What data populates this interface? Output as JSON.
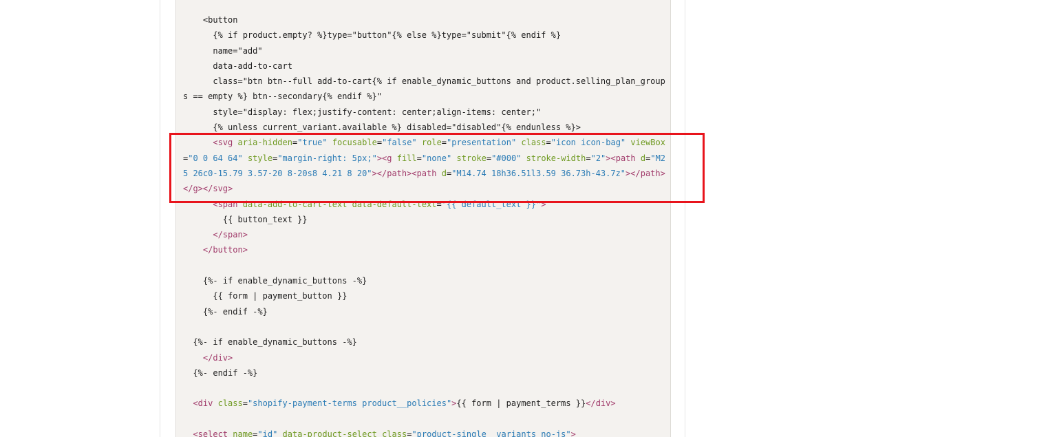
{
  "colors": {
    "code_background": "#f4f2ef",
    "text": "#1f1f1f",
    "tag": "#a03a6a",
    "attribute": "#6f9a22",
    "value": "#2a7bb5",
    "highlight_border": "#e8141c"
  },
  "code": {
    "language": "liquid-html",
    "lines": [
      [
        {
          "t": "text",
          "s": "    <button"
        }
      ],
      [
        {
          "t": "text",
          "s": "      {% if product.empty? %}type=\"button\"{% else %}type=\"submit\"{% endif %}"
        }
      ],
      [
        {
          "t": "text",
          "s": "      name=\"add\""
        }
      ],
      [
        {
          "t": "text",
          "s": "      data-add-to-cart"
        }
      ],
      [
        {
          "t": "text",
          "s": "      class=\"btn btn--full add-to-cart{% if enable_dynamic_buttons and product.selling_plan_group"
        }
      ],
      [
        {
          "t": "text",
          "s": "s == empty %} btn--secondary{% endif %}\""
        }
      ],
      [
        {
          "t": "text",
          "s": "      style=\"display: flex;justify-content: center;align-items: center;\""
        }
      ],
      [
        {
          "t": "text",
          "s": "      {% unless current_variant.available %} disabled=\"disabled\"{% endunless %}>"
        }
      ],
      [
        {
          "t": "text",
          "s": "      "
        },
        {
          "t": "tag",
          "s": "<svg"
        },
        {
          "t": "text",
          "s": " "
        },
        {
          "t": "attr",
          "s": "aria-hidden"
        },
        {
          "t": "text",
          "s": "="
        },
        {
          "t": "val",
          "s": "\"true\""
        },
        {
          "t": "text",
          "s": " "
        },
        {
          "t": "attr",
          "s": "focusable"
        },
        {
          "t": "text",
          "s": "="
        },
        {
          "t": "val",
          "s": "\"false\""
        },
        {
          "t": "text",
          "s": " "
        },
        {
          "t": "attr",
          "s": "role"
        },
        {
          "t": "text",
          "s": "="
        },
        {
          "t": "val",
          "s": "\"presentation\""
        },
        {
          "t": "text",
          "s": " "
        },
        {
          "t": "attr",
          "s": "class"
        },
        {
          "t": "text",
          "s": "="
        },
        {
          "t": "val",
          "s": "\"icon icon-bag\""
        },
        {
          "t": "text",
          "s": " "
        },
        {
          "t": "attr",
          "s": "viewBox"
        }
      ],
      [
        {
          "t": "text",
          "s": "="
        },
        {
          "t": "val",
          "s": "\"0 0 64 64\""
        },
        {
          "t": "text",
          "s": " "
        },
        {
          "t": "attr",
          "s": "style"
        },
        {
          "t": "text",
          "s": "="
        },
        {
          "t": "val",
          "s": "\"margin-right: 5px;\""
        },
        {
          "t": "tag",
          "s": "><g"
        },
        {
          "t": "text",
          "s": " "
        },
        {
          "t": "attr",
          "s": "fill"
        },
        {
          "t": "text",
          "s": "="
        },
        {
          "t": "val",
          "s": "\"none\""
        },
        {
          "t": "text",
          "s": " "
        },
        {
          "t": "attr",
          "s": "stroke"
        },
        {
          "t": "text",
          "s": "="
        },
        {
          "t": "val",
          "s": "\"#000\""
        },
        {
          "t": "text",
          "s": " "
        },
        {
          "t": "attr",
          "s": "stroke-width"
        },
        {
          "t": "text",
          "s": "="
        },
        {
          "t": "val",
          "s": "\"2\""
        },
        {
          "t": "tag",
          "s": "><path"
        },
        {
          "t": "text",
          "s": " "
        },
        {
          "t": "attr",
          "s": "d"
        },
        {
          "t": "text",
          "s": "="
        },
        {
          "t": "val",
          "s": "\"M2"
        }
      ],
      [
        {
          "t": "val",
          "s": "5 26c0-15.79 3.57-20 8-20s8 4.21 8 20\""
        },
        {
          "t": "tag",
          "s": "></path><path"
        },
        {
          "t": "text",
          "s": " "
        },
        {
          "t": "attr",
          "s": "d"
        },
        {
          "t": "text",
          "s": "="
        },
        {
          "t": "val",
          "s": "\"M14.74 18h36.51l3.59 36.73h-43.7z\""
        },
        {
          "t": "tag",
          "s": "></path>"
        }
      ],
      [
        {
          "t": "tag",
          "s": "</g></svg>"
        }
      ],
      [
        {
          "t": "text",
          "s": "      "
        },
        {
          "t": "tag",
          "s": "<span"
        },
        {
          "t": "text",
          "s": " "
        },
        {
          "t": "attr",
          "s": "data-add-to-cart-text"
        },
        {
          "t": "text",
          "s": " "
        },
        {
          "t": "attr",
          "s": "data-default-text"
        },
        {
          "t": "text",
          "s": "="
        },
        {
          "t": "val",
          "s": "\"{{ default_text }}\""
        },
        {
          "t": "tag",
          "s": ">"
        }
      ],
      [
        {
          "t": "text",
          "s": "        {{ button_text }}"
        }
      ],
      [
        {
          "t": "text",
          "s": "      "
        },
        {
          "t": "tag",
          "s": "</span>"
        }
      ],
      [
        {
          "t": "text",
          "s": "    "
        },
        {
          "t": "tag",
          "s": "</button>"
        }
      ],
      [
        {
          "t": "text",
          "s": ""
        }
      ],
      [
        {
          "t": "text",
          "s": "    {%- if enable_dynamic_buttons -%}"
        }
      ],
      [
        {
          "t": "text",
          "s": "      {{ form | payment_button }}"
        }
      ],
      [
        {
          "t": "text",
          "s": "    {%- endif -%}"
        }
      ],
      [
        {
          "t": "text",
          "s": ""
        }
      ],
      [
        {
          "t": "text",
          "s": "  {%- if enable_dynamic_buttons -%}"
        }
      ],
      [
        {
          "t": "text",
          "s": "    "
        },
        {
          "t": "tag",
          "s": "</div>"
        }
      ],
      [
        {
          "t": "text",
          "s": "  {%- endif -%}"
        }
      ],
      [
        {
          "t": "text",
          "s": ""
        }
      ],
      [
        {
          "t": "text",
          "s": "  "
        },
        {
          "t": "tag",
          "s": "<div"
        },
        {
          "t": "text",
          "s": " "
        },
        {
          "t": "attr",
          "s": "class"
        },
        {
          "t": "text",
          "s": "="
        },
        {
          "t": "val",
          "s": "\"shopify-payment-terms product__policies\""
        },
        {
          "t": "tag",
          "s": ">"
        },
        {
          "t": "text",
          "s": "{{ form | payment_terms }}"
        },
        {
          "t": "tag",
          "s": "</div>"
        }
      ],
      [
        {
          "t": "text",
          "s": ""
        }
      ],
      [
        {
          "t": "text",
          "s": "  "
        },
        {
          "t": "tag",
          "s": "<select"
        },
        {
          "t": "text",
          "s": " "
        },
        {
          "t": "attr",
          "s": "name"
        },
        {
          "t": "text",
          "s": "="
        },
        {
          "t": "val",
          "s": "\"id\""
        },
        {
          "t": "text",
          "s": " "
        },
        {
          "t": "attr",
          "s": "data-product-select"
        },
        {
          "t": "text",
          "s": " "
        },
        {
          "t": "attr",
          "s": "class"
        },
        {
          "t": "text",
          "s": "="
        },
        {
          "t": "val",
          "s": "\"product-single__variants no-js\""
        },
        {
          "t": "tag",
          "s": ">"
        }
      ]
    ]
  }
}
